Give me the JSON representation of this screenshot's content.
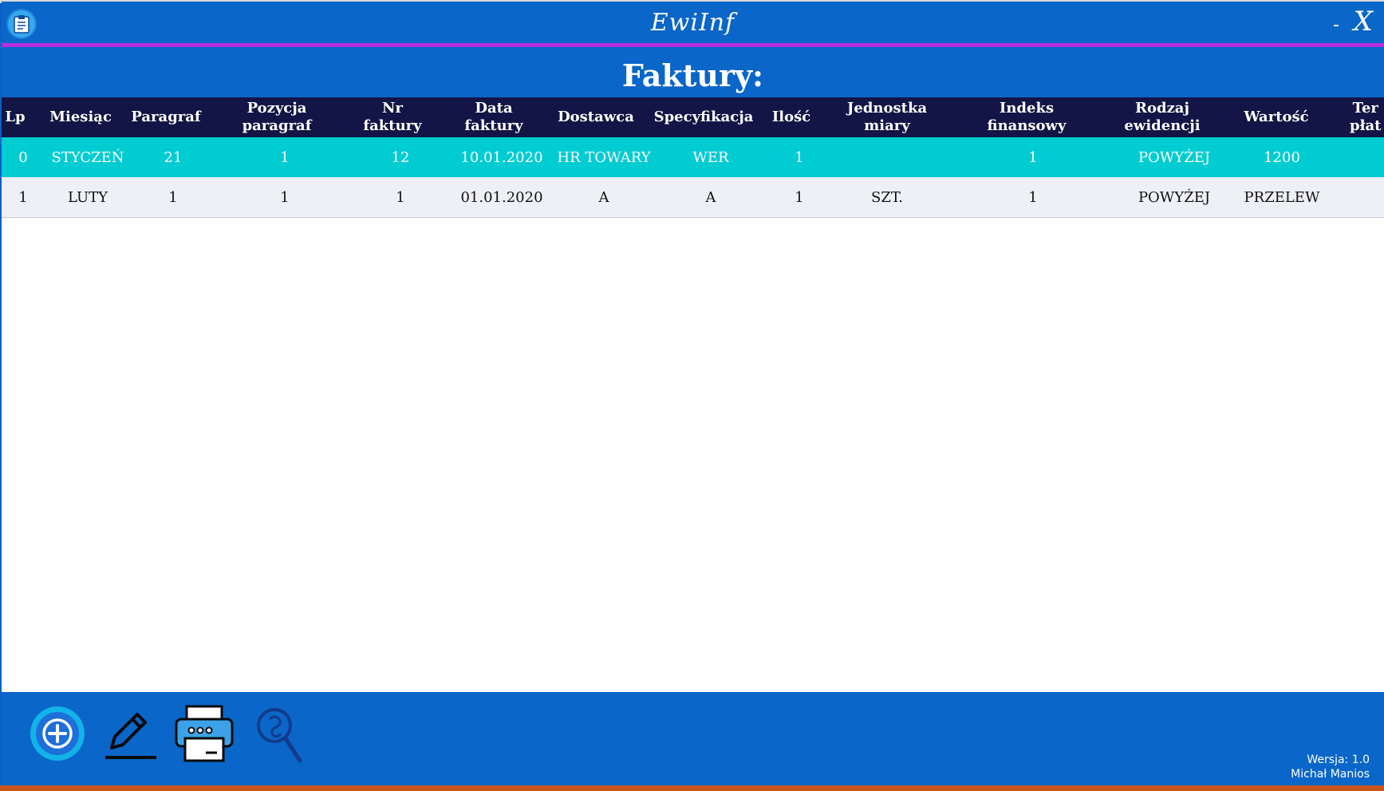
{
  "window": {
    "title": "EwiInf",
    "minimize_label": "-",
    "close_label": "X"
  },
  "page": {
    "title": "Faktury:"
  },
  "grid": {
    "columns": [
      {
        "label": "Lp"
      },
      {
        "label": "Miesiąc"
      },
      {
        "label": "Paragraf"
      },
      {
        "label": "Pozycja\nparagraf"
      },
      {
        "label": "Nr\nfaktury"
      },
      {
        "label": "Data\nfaktury"
      },
      {
        "label": "Dostawca"
      },
      {
        "label": "Specyfikacja"
      },
      {
        "label": "Ilość"
      },
      {
        "label": "Jednostka\nmiary"
      },
      {
        "label": "Indeks\nfinansowy"
      },
      {
        "label": "Rodzaj\newidencji"
      },
      {
        "label": "Wartość"
      },
      {
        "label": "Ter\npłat"
      }
    ],
    "rows": [
      {
        "selected": true,
        "cells": [
          "0",
          "STYCZEŃ",
          "21",
          "1",
          "12",
          "10.01.2020",
          "HR TOWARY",
          "WER",
          "1",
          "",
          "1",
          "POWYŻEJ",
          "1200",
          ""
        ]
      },
      {
        "selected": false,
        "cells": [
          "1",
          "LUTY",
          "1",
          "1",
          "1",
          "01.01.2020",
          "A",
          "A",
          "1",
          "SZT.",
          "1",
          "POWYŻEJ",
          "PRZELEW",
          ""
        ]
      }
    ]
  },
  "scrollbar": {
    "left_arrow": "<",
    "right_arrow": ">"
  },
  "toolbar": {
    "buttons": [
      {
        "name": "add-button",
        "icon": "plus-circle-icon"
      },
      {
        "name": "edit-button",
        "icon": "pencil-icon"
      },
      {
        "name": "print-button",
        "icon": "printer-icon"
      },
      {
        "name": "search-button",
        "icon": "magnifier-icon"
      }
    ]
  },
  "footer": {
    "version": "Wersja: 1.0",
    "author": "Michał Manios"
  },
  "colors": {
    "app_background": "#0a66c8",
    "accent_line": "#b52ee0",
    "header_background": "#121545",
    "selected_row": "#00ccd1",
    "row_background": "#eef0f5"
  }
}
